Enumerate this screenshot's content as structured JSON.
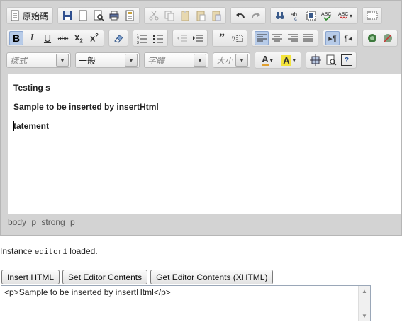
{
  "toolbar": {
    "source_label": "原始碼",
    "styles_placeholder": "樣式",
    "format_value": "一般",
    "font_placeholder": "字體",
    "size_placeholder": "大小"
  },
  "content": {
    "paragraphs": [
      "Testing s",
      "Sample to be inserted by insertHtml",
      "tatement"
    ]
  },
  "statusbar": {
    "path": "body p strong p"
  },
  "message": {
    "prefix": "Instance",
    "instance": "editor1",
    "suffix": "loaded."
  },
  "actions": {
    "insert_html": "Insert HTML",
    "set_contents": "Set Editor Contents",
    "get_contents": "Get Editor Contents (XHTML)"
  },
  "output": {
    "value": "<p>Sample to be inserted by insertHtml</p>"
  }
}
